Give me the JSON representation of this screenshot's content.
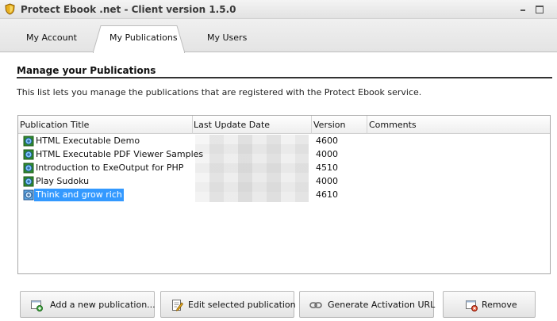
{
  "window": {
    "title": "Protect Ebook .net - Client version 1.5.0"
  },
  "tabs": [
    {
      "label": "My Account",
      "active": false
    },
    {
      "label": "My Publications",
      "active": true
    },
    {
      "label": "My Users",
      "active": false
    }
  ],
  "section": {
    "title": "Manage your Publications",
    "description": "This list lets you manage the publications that are registered with the Protect Ebook service."
  },
  "list": {
    "columns": [
      "Publication Title",
      "Last Update Date",
      "Version",
      "Comments"
    ],
    "rows": [
      {
        "title": "HTML Executable Demo",
        "version": "4600",
        "selected": false
      },
      {
        "title": "HTML Executable PDF Viewer Samples",
        "version": "4000",
        "selected": false
      },
      {
        "title": "Introduction to ExeOutput for PHP",
        "version": "4510",
        "selected": false
      },
      {
        "title": "Play Sudoku",
        "version": "4000",
        "selected": false
      },
      {
        "title": "Think and grow rich",
        "version": "4610",
        "selected": true
      }
    ]
  },
  "buttons": {
    "add": "Add a new publication...",
    "edit": "Edit selected publication",
    "generate": "Generate Activation URL",
    "remove": "Remove"
  },
  "colors": {
    "selection": "#3399ff",
    "rule": "#333333"
  }
}
